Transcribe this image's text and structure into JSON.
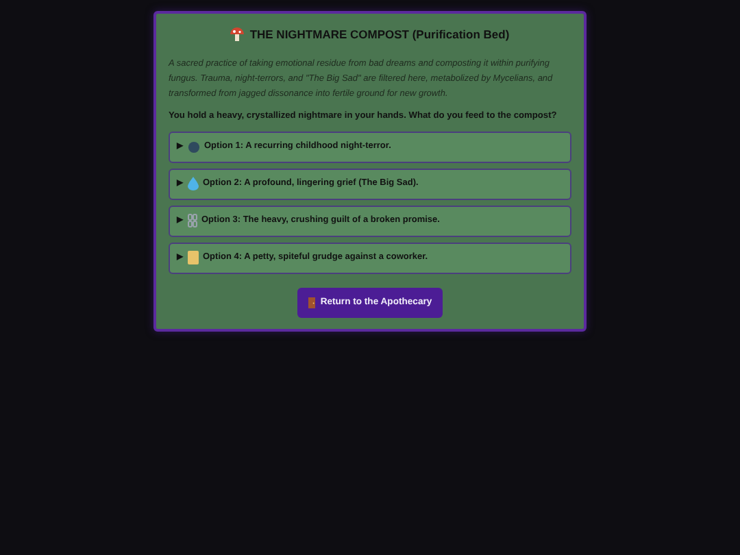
{
  "panel": {
    "title": "THE NIGHTMARE COMPOST (Purification Bed)",
    "description": "A sacred practice of taking emotional residue from bad dreams and composting it within purifying fungus. Trauma, night-terrors, and \"The Big Sad\" are filtered here, metabolized by Mycelians, and transformed from jagged dissonance into fertile ground for new growth.",
    "prompt": "You hold a heavy, crystallized nightmare in your hands. What do you feed to the compost?",
    "options": [
      {
        "marker": "▶",
        "label": "Option 1: A recurring childhood night-terror."
      },
      {
        "marker": "▶",
        "label": "Option 2: A profound, lingering grief (The Big Sad)."
      },
      {
        "marker": "▶",
        "label": "Option 3: The heavy, crushing guilt of a broken promise."
      },
      {
        "marker": "▶",
        "label": "Option 4: A petty, spiteful grudge against a coworker."
      }
    ],
    "button": {
      "label": "Return to the Apothecary"
    }
  }
}
